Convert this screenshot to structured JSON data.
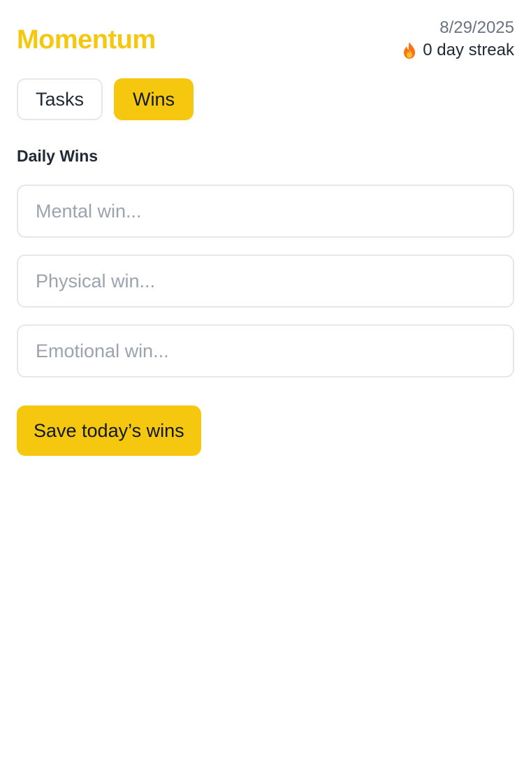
{
  "app": {
    "title": "Momentum",
    "date": "8/29/2025",
    "streak_icon": "fire-icon",
    "streak_text": "0 day streak"
  },
  "tabs": [
    {
      "label": "Tasks",
      "active": false
    },
    {
      "label": "Wins",
      "active": true
    }
  ],
  "wins": {
    "section_title": "Daily Wins",
    "fields": [
      {
        "value": "",
        "placeholder": "Mental win..."
      },
      {
        "value": "",
        "placeholder": "Physical win..."
      },
      {
        "value": "",
        "placeholder": "Emotional win..."
      }
    ],
    "save_label": "Save today’s wins"
  },
  "colors": {
    "accent": "#f5c70e",
    "border": "#e5e7eb",
    "muted_text": "#6b7280",
    "placeholder": "#9ca3af"
  }
}
